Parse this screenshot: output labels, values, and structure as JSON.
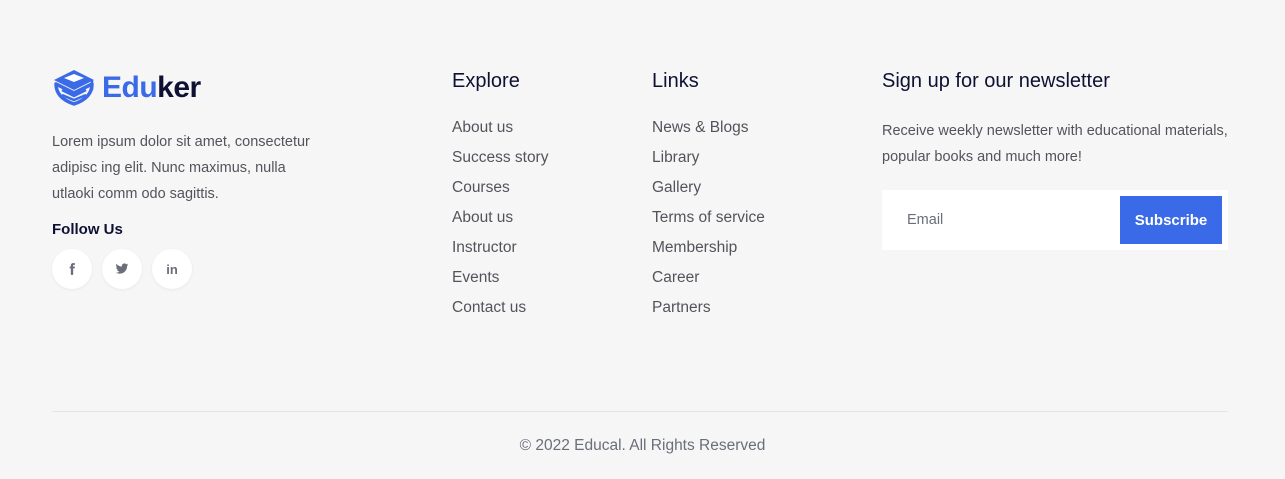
{
  "brand": {
    "name_part1": "Edu",
    "name_part2": "ker",
    "icon": "graduation-cap-book-icon",
    "accent_color": "#3a6ae8"
  },
  "about": {
    "text": "Lorem ipsum dolor sit amet, consectetur adipisc ing elit. Nunc maximus, nulla utlaoki comm odo sagittis."
  },
  "follow": {
    "title": "Follow Us",
    "socials": [
      {
        "name": "facebook",
        "icon": "facebook-icon"
      },
      {
        "name": "twitter",
        "icon": "twitter-icon"
      },
      {
        "name": "linkedin",
        "icon": "linkedin-icon",
        "glyph": "in"
      }
    ]
  },
  "explore": {
    "title": "Explore",
    "items": [
      "About us",
      "Success story",
      "Courses",
      "About us",
      "Instructor",
      "Events",
      "Contact us"
    ]
  },
  "links": {
    "title": "Links",
    "items": [
      "News & Blogs",
      "Library",
      "Gallery",
      "Terms of service",
      "Membership",
      "Career",
      "Partners"
    ]
  },
  "newsletter": {
    "title": "Sign up for our newsletter",
    "description": "Receive weekly newsletter with educational materials, popular books and much more!",
    "email_placeholder": "Email",
    "email_value": "",
    "button_label": "Subscribe"
  },
  "footer": {
    "copyright": "© 2022 Educal. All Rights Reserved"
  }
}
